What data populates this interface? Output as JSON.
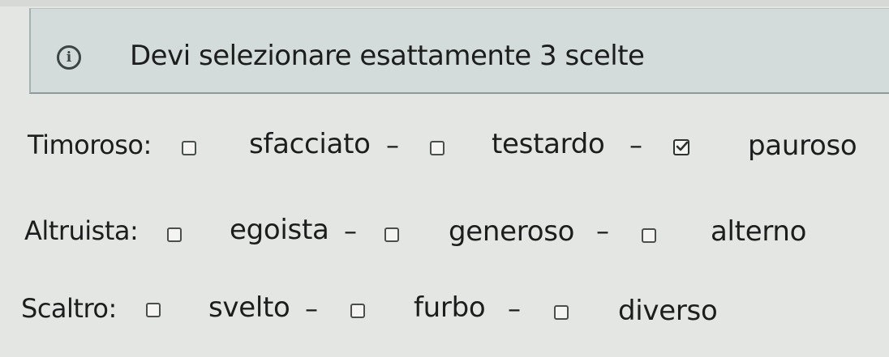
{
  "notice": {
    "icon": "info-icon",
    "icon_glyph": "i",
    "text": "Devi selezionare esattamente 3 scelte"
  },
  "separator": "–",
  "questions": [
    {
      "label": "Timoroso:",
      "options": [
        {
          "label": "sfacciato",
          "checked": false
        },
        {
          "label": "testardo",
          "checked": false
        },
        {
          "label": "pauroso",
          "checked": true
        }
      ]
    },
    {
      "label": "Altruista:",
      "options": [
        {
          "label": "egoista",
          "checked": false
        },
        {
          "label": "generoso",
          "checked": false
        },
        {
          "label": "alterno",
          "checked": false
        }
      ]
    },
    {
      "label": "Scaltro:",
      "options": [
        {
          "label": "svelto",
          "checked": false
        },
        {
          "label": "furbo",
          "checked": false
        },
        {
          "label": "diverso",
          "checked": false
        }
      ]
    }
  ]
}
